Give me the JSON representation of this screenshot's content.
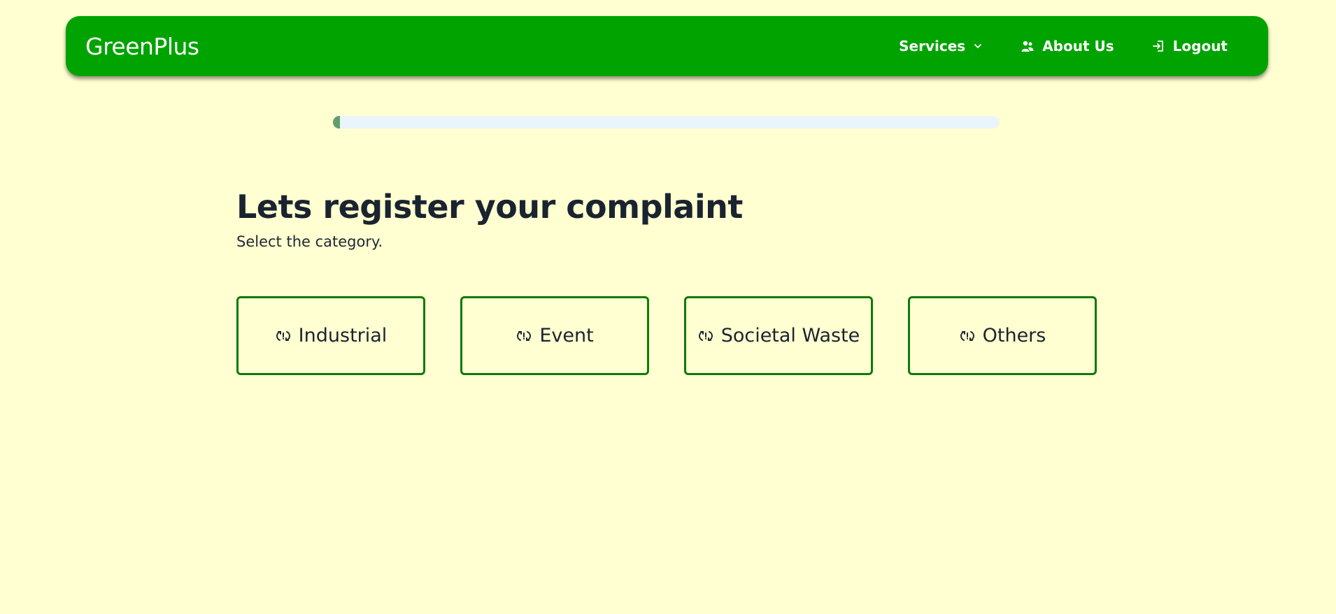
{
  "navbar": {
    "brand": "GreenPlus",
    "links": [
      {
        "label": "Services",
        "icon": "chevron-down-icon"
      },
      {
        "label": "About Us",
        "icon": "users-icon"
      },
      {
        "label": "Logout",
        "icon": "logout-icon"
      }
    ],
    "colors": {
      "background": "#00a300",
      "text": "#ffffff"
    }
  },
  "progress": {
    "value_percent": 1
  },
  "main": {
    "title": "Lets register your complaint",
    "subtitle": "Select the category."
  },
  "categories": [
    {
      "label": "Industrial",
      "icon": "recycle-icon"
    },
    {
      "label": "Event",
      "icon": "recycle-icon"
    },
    {
      "label": "Societal Waste",
      "icon": "recycle-icon"
    },
    {
      "label": "Others",
      "icon": "recycle-icon"
    }
  ],
  "colors": {
    "page_background": "#ffffd1",
    "card_border": "#0d7a0d",
    "progress_fill": "#5f9f6b"
  }
}
